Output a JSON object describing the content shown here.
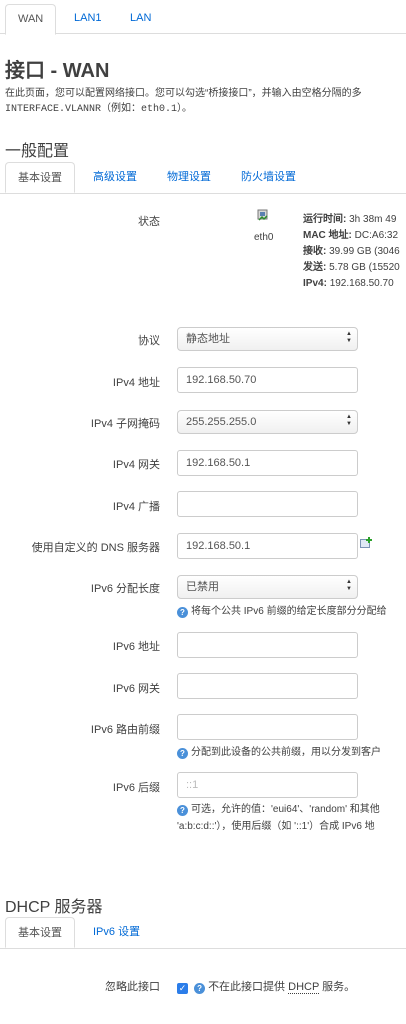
{
  "top_tabs": [
    "WAN",
    "LAN1",
    "LAN"
  ],
  "title": "接口 - WAN",
  "description_line1": "在此页面，您可以配置网络接口。您可以勾选“桥接接口”，并输入由空格分隔的多",
  "description_line2_mono": "INTERFACE.VLANNR",
  "description_line2_rest": "（例如：",
  "description_line2_example": "eth0.1",
  "description_line2_end": "）。",
  "general_section": {
    "title": "一般配置",
    "tabs": [
      "基本设置",
      "高级设置",
      "物理设置",
      "防火墙设置"
    ]
  },
  "status": {
    "label": "状态",
    "device": "eth0",
    "uptime_label": "运行时间:",
    "uptime_value": "3h 38m 49",
    "mac_label": "MAC 地址:",
    "mac_value": "DC:A6:32",
    "rx_label": "接收:",
    "rx_value": "39.99 GB (3046",
    "tx_label": "发送:",
    "tx_value": "5.78 GB (15520",
    "ipv4_label": "IPv4:",
    "ipv4_value": "192.168.50.70"
  },
  "form": {
    "protocol_label": "协议",
    "protocol_value": "静态地址",
    "ipv4_addr_label": "IPv4 地址",
    "ipv4_addr_value": "192.168.50.70",
    "ipv4_mask_label": "IPv4 子网掩码",
    "ipv4_mask_value": "255.255.255.0",
    "ipv4_gw_label": "IPv4 网关",
    "ipv4_gw_value": "192.168.50.1",
    "ipv4_bcast_label": "IPv4 广播",
    "ipv4_bcast_value": "",
    "dns_label": "使用自定义的 DNS 服务器",
    "dns_value": "192.168.50.1",
    "ipv6_assign_label": "IPv6 分配长度",
    "ipv6_assign_value": "已禁用",
    "ipv6_assign_help": "将每个公共 IPv6 前缀的给定长度部分分配给",
    "ipv6_addr_label": "IPv6 地址",
    "ipv6_gw_label": "IPv6 网关",
    "ipv6_prefix_label": "IPv6 路由前缀",
    "ipv6_prefix_help": "分配到此设备的公共前缀，用以分发到客户",
    "ipv6_suffix_label": "IPv6 后缀",
    "ipv6_suffix_placeholder": "::1",
    "ipv6_suffix_help1": "可选，允许的值：'eui64'、'random' 和其他",
    "ipv6_suffix_help2": "'a:b:c:d::'），使用后缀（如 '::1'）合成 IPv6 地"
  },
  "dhcp_section": {
    "title": "DHCP 服务器",
    "tabs": [
      "基本设置",
      "IPv6 设置"
    ],
    "ignore_label": "忽略此接口",
    "ignore_checked": true,
    "ignore_help_pre": "不在此接口提供",
    "ignore_help_dhcp": "DHCP",
    "ignore_help_post": "服务。"
  }
}
